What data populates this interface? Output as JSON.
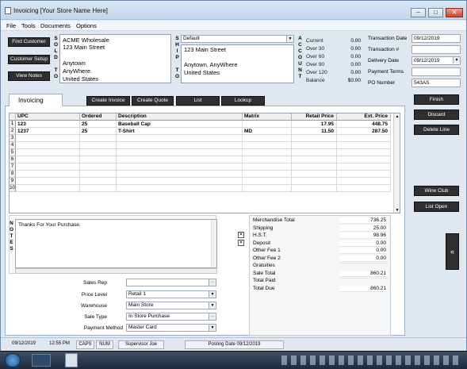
{
  "window": {
    "title": "Invoicing  [Your Store Name Here]",
    "minimize": "–",
    "maximize": "□",
    "close": "✕"
  },
  "menu": [
    "File",
    "Tools",
    "Documents",
    "Options"
  ],
  "left_buttons": [
    "Find Customer",
    "Customer Setup",
    "View Notes"
  ],
  "sold_to": {
    "letters": [
      "S",
      "O",
      "L",
      "D",
      "",
      "T",
      "O"
    ],
    "lines": [
      "ACME Wholesale",
      "123 Main Street",
      "",
      "Anytown",
      "AnyWhere",
      "United States"
    ]
  },
  "ship_to": {
    "letters": [
      "S",
      "H",
      "I",
      "P",
      "",
      "T",
      "O"
    ],
    "selected": "Default",
    "lines": [
      "123 Main Street",
      "",
      "Anytown, AnyWhere",
      "United States"
    ]
  },
  "account": {
    "letters": [
      "A",
      "C",
      "C",
      "O",
      "U",
      "N",
      "T"
    ],
    "rows": [
      {
        "label": "Current",
        "value": "0.00"
      },
      {
        "label": "Over 30",
        "value": "0.00"
      },
      {
        "label": "Over 60",
        "value": "0.00"
      },
      {
        "label": "Over 90",
        "value": "0.00"
      },
      {
        "label": "Over 120",
        "value": "0.00"
      },
      {
        "label": "Balance",
        "value": "$0.00"
      }
    ]
  },
  "transaction": {
    "date_label": "Transaction Date",
    "date": "09/12/2019",
    "num_label": "Transaction #",
    "num": "",
    "delivery_label": "Delivery Date",
    "delivery": "09/12/2019",
    "terms_label": "Payment Terms",
    "terms": "",
    "po_label": "PO Number",
    "po": "543AS"
  },
  "tab": {
    "label": "Invoicing"
  },
  "toolbar": [
    "Create Invoice",
    "Create Quote",
    "List",
    "Lookup"
  ],
  "right_buttons": [
    "Finish",
    "Discard",
    "Delete Line",
    "Wine Club",
    "List Open"
  ],
  "side_arrow": "«",
  "grid": {
    "headers": [
      "UPC",
      "Ordered",
      "Description",
      "Matrix",
      "Retail Price",
      "Ext. Price"
    ],
    "rows": [
      [
        "123",
        "25",
        "Baseball Cap",
        "",
        "17.95",
        "448.75"
      ],
      [
        "1237",
        "25",
        "T-Shirt",
        "MD",
        "11.50",
        "287.50"
      ],
      [
        "",
        "",
        "",
        "",
        "",
        ""
      ],
      [
        "",
        "",
        "",
        "",
        "",
        ""
      ],
      [
        "",
        "",
        "",
        "",
        "",
        ""
      ],
      [
        "",
        "",
        "",
        "",
        "",
        ""
      ],
      [
        "",
        "",
        "",
        "",
        "",
        ""
      ],
      [
        "",
        "",
        "",
        "",
        "",
        ""
      ],
      [
        "",
        "",
        "",
        "",
        "",
        ""
      ],
      [
        "",
        "",
        "",
        "",
        "",
        ""
      ]
    ],
    "row_numbers": [
      "1",
      "2",
      "3",
      "4",
      "5",
      "6",
      "7",
      "8",
      "9",
      "10"
    ]
  },
  "notes": {
    "letters": [
      "N",
      "O",
      "T",
      "E",
      "S"
    ],
    "text": "Thanks For Your Purchase."
  },
  "form": [
    {
      "label": "Sales Rep",
      "value": "",
      "kind": "ellipsis"
    },
    {
      "label": "Price Level",
      "value": "Retail 1",
      "kind": "dropdown"
    },
    {
      "label": "Warehouse",
      "value": "Main Store",
      "kind": "dropdown"
    },
    {
      "label": "Sale Type",
      "value": "In Store Purchase",
      "kind": "ellipsis"
    },
    {
      "label": "Payment Method",
      "value": "Master Card",
      "kind": "dropdown"
    }
  ],
  "totals": [
    {
      "label": "Merchandise Total",
      "value": "736.25"
    },
    {
      "label": "Shipping",
      "value": "25.00"
    },
    {
      "label": "H.S.T.",
      "value": "98.96"
    },
    {
      "label": "Deposit",
      "value": "0.00"
    },
    {
      "label": "Other Fee 1",
      "value": "0.00"
    },
    {
      "label": "Other Fee 2",
      "value": "0.00"
    },
    {
      "label": "Gratuities",
      "value": ""
    },
    {
      "label": "Sale Total",
      "value": "860.21"
    },
    {
      "label": "Total Paid",
      "value": ""
    },
    {
      "label": "Total Due",
      "value": "860.21"
    }
  ],
  "status": {
    "date": "09/12/2019",
    "time": "12:55 PM",
    "caps": "CAPS",
    "num": "NUM",
    "user": "Supervisor Joe",
    "posting": "Posting Date 09/12/2019"
  }
}
